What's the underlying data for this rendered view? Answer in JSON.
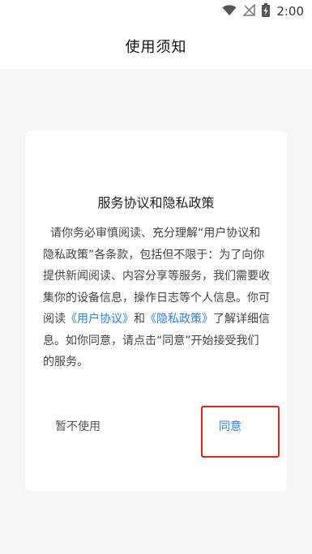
{
  "status_bar": {
    "time": "2:00",
    "icons": [
      "wifi-icon",
      "signal-off-icon",
      "battery-charging-icon"
    ]
  },
  "header": {
    "title": "使用须知"
  },
  "dialog": {
    "title": "服务协议和隐私政策",
    "body": {
      "text_1": "请你务必审慎阅读、充分理解“用户协议和隐私政策”各条款，包括但不限于：为了向你提供新闻阅读、内容分享等服务，我们需要收集你的设备信息，操作日志等个人信息。你可阅读",
      "link_user_agreement": "《用户协议》",
      "text_2": "和",
      "link_privacy_policy": "《隐私政策》",
      "text_3": "了解详细信息。如你同意，请点击“同意”开始接受我们的服务。"
    },
    "decline_label": "暂不使用",
    "agree_label": "同意"
  },
  "colors": {
    "link": "#2f7fd4",
    "highlight": "#e0261f",
    "background": "#f6f6f6"
  }
}
